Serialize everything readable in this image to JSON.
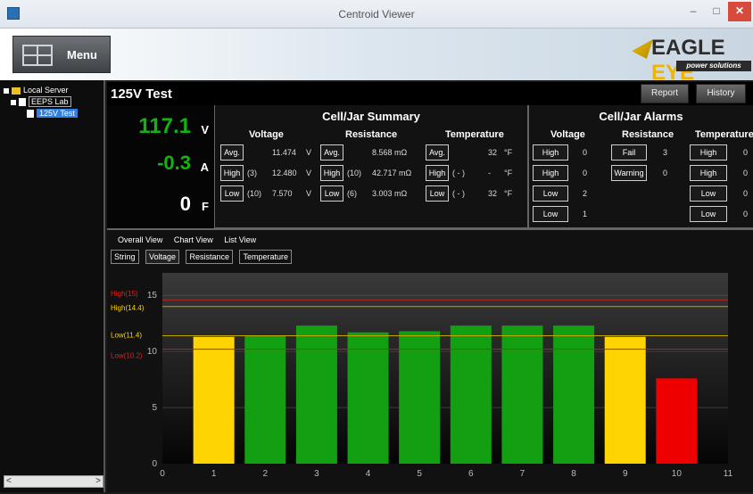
{
  "window": {
    "title": "Centroid Viewer",
    "min": "–",
    "max": "□",
    "close": "✕"
  },
  "header": {
    "menu_label": "Menu",
    "logo_text_a": "EAGLE",
    "logo_text_b": "EYE",
    "logo_sub": "power solutions"
  },
  "tree": {
    "server": "Local Server",
    "lab": "EEPS Lab",
    "test": "125V Test"
  },
  "sidebar_scroll": {
    "left": "<",
    "right": ">"
  },
  "page": {
    "title": "125V Test",
    "report_button": "Report",
    "history_button": "History"
  },
  "readings": {
    "voltage": "117.1",
    "voltage_unit": "V",
    "current": "-0.3",
    "current_unit": "A",
    "temperature": "0",
    "temperature_unit": "F"
  },
  "summary": {
    "title": "Cell/Jar Summary",
    "voltage_header": "Voltage",
    "resistance_header": "Resistance",
    "temperature_header": "Temperature",
    "rows": [
      {
        "label": "Avg.",
        "v_idx": "",
        "v_val": "11.474",
        "v_unit": "V",
        "r_label": "Avg.",
        "r_idx": "",
        "r_val": "8.568 mΩ",
        "t_label": "Avg.",
        "t_idx": "",
        "t_val": "32",
        "t_unit": "°F"
      },
      {
        "label": "High",
        "v_idx": "(3)",
        "v_val": "12.480",
        "v_unit": "V",
        "r_label": "High",
        "r_idx": "(10)",
        "r_val": "42.717 mΩ",
        "t_label": "High",
        "t_idx": "( - )",
        "t_val": "-",
        "t_unit": "°F"
      },
      {
        "label": "Low",
        "v_idx": "(10)",
        "v_val": "7.570",
        "v_unit": "V",
        "r_label": "Low",
        "r_idx": "(6)",
        "r_val": "3.003 mΩ",
        "t_label": "Low",
        "t_idx": "( - )",
        "t_val": "32",
        "t_unit": "°F"
      }
    ]
  },
  "alarms": {
    "title": "Cell/Jar Alarms",
    "voltage_header": "Voltage",
    "resistance_header": "Resistance",
    "temperature_header": "Temperature",
    "voltage": [
      {
        "label": "High",
        "count": "0"
      },
      {
        "label": "High",
        "count": "0"
      },
      {
        "label": "Low",
        "count": "2"
      },
      {
        "label": "Low",
        "count": "1"
      }
    ],
    "resistance": [
      {
        "label": "Fail",
        "count": "3"
      },
      {
        "label": "Warning",
        "count": "0"
      }
    ],
    "temperature": [
      {
        "label": "High",
        "count": "0"
      },
      {
        "label": "High",
        "count": "0"
      },
      {
        "label": "Low",
        "count": "0"
      },
      {
        "label": "Low",
        "count": "0"
      }
    ]
  },
  "views": [
    "Overall View",
    "Chart View",
    "List View"
  ],
  "tabs": [
    "String",
    "Voltage",
    "Resistance",
    "Temperature"
  ],
  "colors": {
    "green": "#12a012",
    "yellow": "#ffd400",
    "red": "#ee0000",
    "limit_red": "#c81e1e",
    "limit_yellow": "#bda800"
  },
  "chart_data": {
    "type": "bar",
    "categories": [
      "1",
      "2",
      "3",
      "4",
      "5",
      "6",
      "7",
      "8",
      "9",
      "10"
    ],
    "values": [
      11.3,
      11.4,
      12.3,
      11.7,
      11.8,
      12.3,
      12.3,
      12.3,
      11.3,
      7.6
    ],
    "bar_colors": [
      "yellow",
      "green",
      "green",
      "green",
      "green",
      "green",
      "green",
      "green",
      "yellow",
      "red"
    ],
    "x_ticks": [
      "0",
      "1",
      "2",
      "3",
      "4",
      "5",
      "6",
      "7",
      "8",
      "9",
      "10",
      "11"
    ],
    "y_ticks": [
      "0",
      "5",
      "10",
      "15"
    ],
    "xlim": [
      0,
      11
    ],
    "ylim": [
      0,
      17
    ],
    "limits": [
      {
        "label": "High(15)",
        "value": 14.6,
        "color": "red"
      },
      {
        "label": "High(14.4)",
        "value": 14.0,
        "color": "yellow"
      },
      {
        "label": "Low(11.4)",
        "value": 11.4,
        "color": "yellow"
      },
      {
        "label": "Low(10.2)",
        "value": 10.2,
        "color": "red"
      }
    ]
  }
}
